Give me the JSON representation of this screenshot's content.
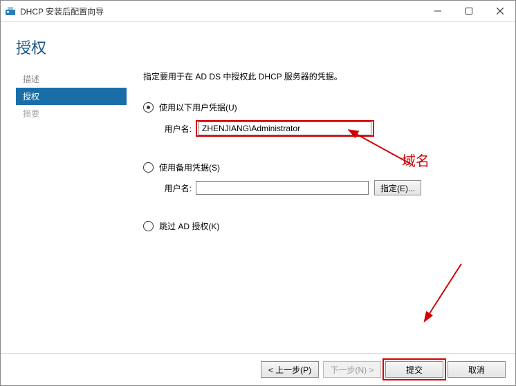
{
  "window": {
    "title": "DHCP 安装后配置向导"
  },
  "heading": "授权",
  "sidebar": {
    "items": [
      {
        "label": "描述",
        "state": "normal"
      },
      {
        "label": "授权",
        "state": "selected"
      },
      {
        "label": "摘要",
        "state": "disabled"
      }
    ]
  },
  "main": {
    "description": "指定要用于在 AD DS 中授权此 DHCP 服务器的凭据。",
    "options": {
      "use_following": {
        "label": "使用以下用户凭据(U)",
        "checked": true,
        "username_label": "用户名:",
        "username_value": "ZHENJIANG\\Administrator"
      },
      "use_alternate": {
        "label": "使用备用凭据(S)",
        "checked": false,
        "username_label": "用户名:",
        "username_value": "",
        "specify_button": "指定(E)..."
      },
      "skip": {
        "label": "跳过 AD 授权(K)",
        "checked": false
      }
    }
  },
  "annotation": {
    "label": "域名"
  },
  "footer": {
    "previous": "< 上一步(P)",
    "next": "下一步(N) >",
    "commit": "提交",
    "cancel": "取消"
  }
}
